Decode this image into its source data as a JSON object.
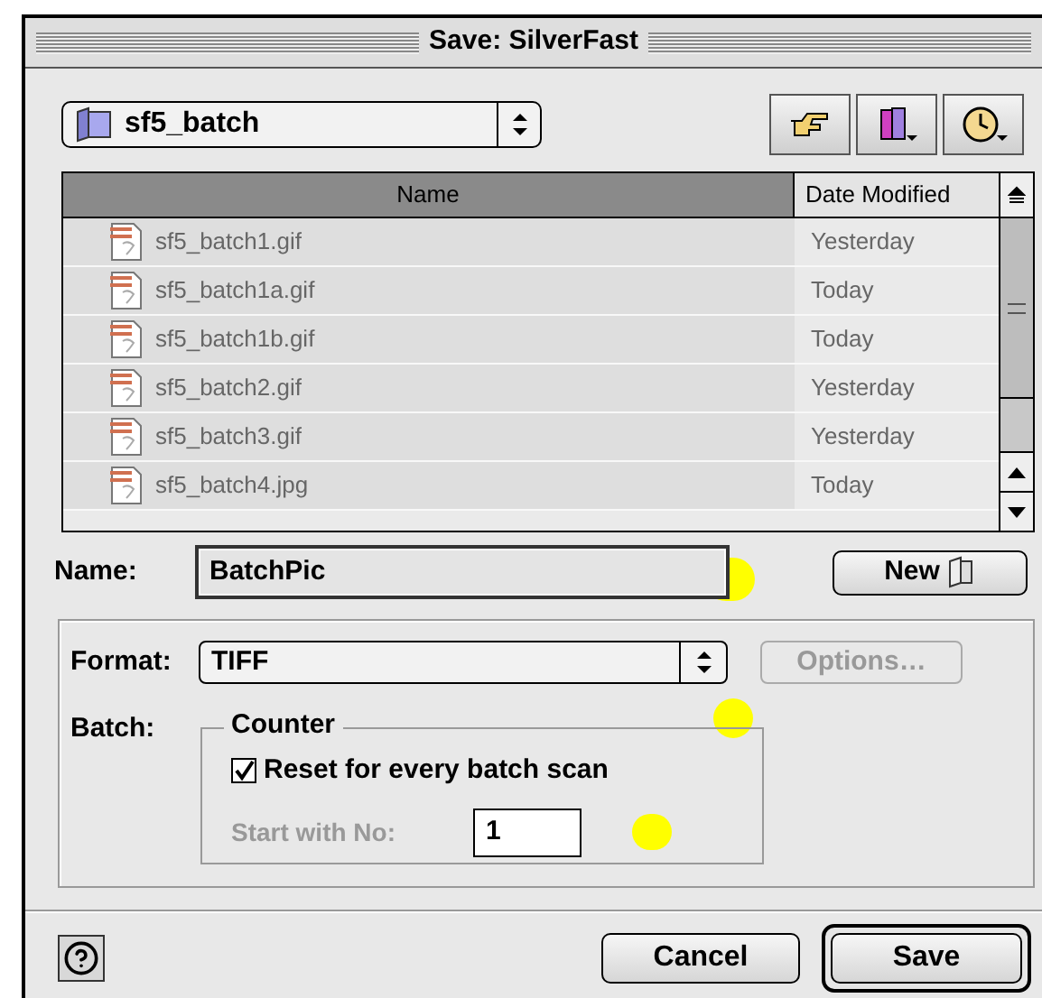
{
  "window": {
    "title": "Save: SilverFast"
  },
  "folder_popup": {
    "value": "sf5_batch"
  },
  "file_list": {
    "columns": [
      {
        "label": "Name",
        "selected": true
      },
      {
        "label": "Date Modified",
        "selected": false
      }
    ],
    "rows": [
      {
        "name": "sf5_batch1.gif",
        "date": "Yesterday"
      },
      {
        "name": "sf5_batch1a.gif",
        "date": "Today"
      },
      {
        "name": "sf5_batch1b.gif",
        "date": "Today"
      },
      {
        "name": "sf5_batch2.gif",
        "date": "Yesterday"
      },
      {
        "name": "sf5_batch3.gif",
        "date": "Yesterday"
      },
      {
        "name": "sf5_batch4.jpg",
        "date": "Today"
      }
    ]
  },
  "name_field": {
    "label": "Name:",
    "value": "BatchPic"
  },
  "new_button": {
    "label": "New"
  },
  "format": {
    "label": "Format:",
    "value": "TIFF"
  },
  "options_button": {
    "label": "Options…",
    "disabled": true
  },
  "batch": {
    "label": "Batch:",
    "group_title": "Counter",
    "reset": {
      "label": "Reset for every batch scan",
      "checked": true
    },
    "start": {
      "label": "Start with No:",
      "value": "1",
      "disabled": true
    }
  },
  "buttons": [
    {
      "label": "Cancel",
      "kind": "normal"
    },
    {
      "label": "Save",
      "kind": "default"
    }
  ]
}
